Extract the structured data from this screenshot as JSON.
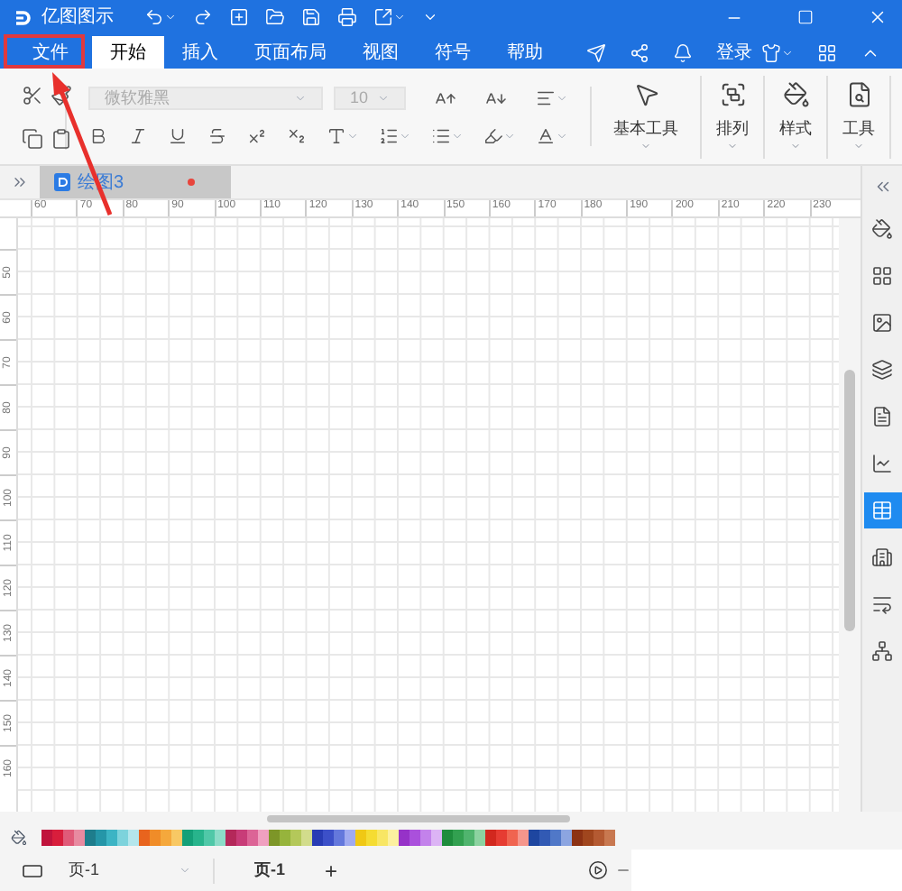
{
  "app": {
    "name": "亿图图示"
  },
  "menu_tabs": [
    {
      "label": "文件",
      "selected": false
    },
    {
      "label": "开始",
      "selected": true
    },
    {
      "label": "插入",
      "selected": false
    },
    {
      "label": "页面布局",
      "selected": false
    },
    {
      "label": "视图",
      "selected": false
    },
    {
      "label": "符号",
      "selected": false
    },
    {
      "label": "帮助",
      "selected": false
    }
  ],
  "login": "登录",
  "toolbar": {
    "font": "微软雅黑",
    "size": "10",
    "tools": [
      {
        "kind": "pointer",
        "label": "基本工具"
      },
      {
        "kind": "arrange",
        "label": "排列"
      },
      {
        "kind": "style",
        "label": "样式"
      },
      {
        "kind": "tools",
        "label": "工具"
      }
    ]
  },
  "document_tabs": [
    {
      "label": "绘图3",
      "selected": true,
      "unsaved": true
    }
  ],
  "ruler": {
    "horizontal": [
      "60",
      "70",
      "80",
      "90",
      "100",
      "110",
      "120",
      "130",
      "140",
      "150",
      "160",
      "170",
      "180",
      "190",
      "200",
      "210",
      "220",
      "230"
    ],
    "vertical": [
      "50",
      "60",
      "70",
      "80",
      "90",
      "100",
      "110",
      "120",
      "130",
      "140",
      "150",
      "160"
    ]
  },
  "sidebar": [
    {
      "kind": "fill",
      "selected": false
    },
    {
      "kind": "grid",
      "selected": false
    },
    {
      "kind": "image",
      "selected": false
    },
    {
      "kind": "layers",
      "selected": false
    },
    {
      "kind": "document",
      "selected": false
    },
    {
      "kind": "chart",
      "selected": false
    },
    {
      "kind": "table",
      "selected": true
    },
    {
      "kind": "building",
      "selected": false
    },
    {
      "kind": "text",
      "selected": false
    },
    {
      "kind": "org",
      "selected": false
    }
  ],
  "palette": [
    {
      "color": "#c0143c"
    },
    {
      "color": "#d81e3c"
    },
    {
      "color": "#e05a78"
    },
    {
      "color": "#e88aa0"
    },
    {
      "color": "#1e7d8c"
    },
    {
      "color": "#2596a8"
    },
    {
      "color": "#3cb4c4"
    },
    {
      "color": "#7dd3dc"
    },
    {
      "color": "#b4e6ec"
    },
    {
      "color": "#e8641e"
    },
    {
      "color": "#f08c28"
    },
    {
      "color": "#f5a83c"
    },
    {
      "color": "#f8c864"
    },
    {
      "color": "#14a078"
    },
    {
      "color": "#28b48c"
    },
    {
      "color": "#50c8a8"
    },
    {
      "color": "#8cdcc8"
    },
    {
      "color": "#b4285a"
    },
    {
      "color": "#c83c78"
    },
    {
      "color": "#dc6496"
    },
    {
      "color": "#f0a0c0"
    },
    {
      "color": "#7d9628"
    },
    {
      "color": "#96b43c"
    },
    {
      "color": "#b4c85a"
    },
    {
      "color": "#d2dc8c"
    },
    {
      "color": "#283cb4"
    },
    {
      "color": "#3c50c8"
    },
    {
      "color": "#6478dc"
    },
    {
      "color": "#a0aaf0"
    },
    {
      "color": "#f0c814"
    },
    {
      "color": "#f5dc32"
    },
    {
      "color": "#f8e664"
    },
    {
      "color": "#fcf0a0"
    },
    {
      "color": "#9632c8"
    },
    {
      "color": "#aa50dc"
    },
    {
      "color": "#c382eb"
    },
    {
      "color": "#dcb4f5"
    },
    {
      "color": "#1e8c3c"
    },
    {
      "color": "#32a050"
    },
    {
      "color": "#50b46e"
    },
    {
      "color": "#8cd2a0"
    },
    {
      "color": "#d2281e"
    },
    {
      "color": "#e63c32"
    },
    {
      "color": "#f06450"
    },
    {
      "color": "#f5968c"
    },
    {
      "color": "#1e46a0"
    },
    {
      "color": "#325ab4"
    },
    {
      "color": "#5078c8"
    },
    {
      "color": "#8ca5e1"
    },
    {
      "color": "#8c3214"
    },
    {
      "color": "#a0461e"
    },
    {
      "color": "#b45a32"
    },
    {
      "color": "#c87850"
    }
  ],
  "page_bar": {
    "page_select": "页-1",
    "pages": [
      {
        "label": "页-1",
        "selected": true
      }
    ],
    "add": "+"
  }
}
